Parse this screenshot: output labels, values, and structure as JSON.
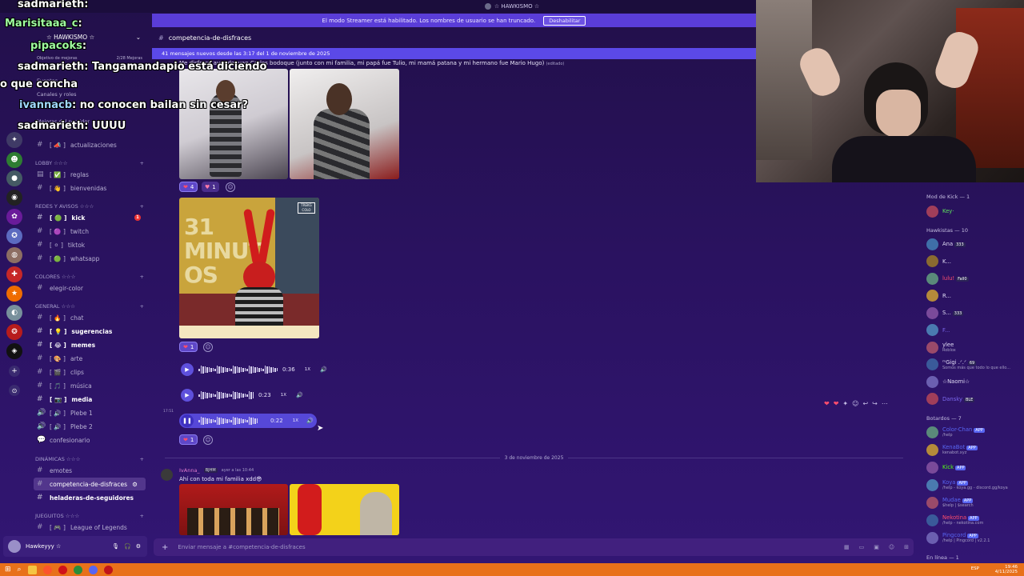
{
  "top_title": "☆ HAWKISMO ☆",
  "streamer_notice": {
    "text": "El modo Streamer está habilitado. Los nombres de usuario se han truncado.",
    "button": "Deshabilitar"
  },
  "server": {
    "name": "☆ HAWKISMO ☆",
    "goal_label": "Objetivo de mejoras",
    "goal_count": "2/28 Mejoras",
    "nav": [
      "Eventos",
      "Canales y roles",
      "Mejoras del servidor"
    ],
    "categories": [
      {
        "name": "LOBBY ☆☆☆"
      },
      {
        "name": "REDES Y AVISOS ☆☆☆"
      },
      {
        "name": "COLORES ☆☆☆"
      },
      {
        "name": "GENERAL ☆☆☆"
      },
      {
        "name": "DINÁMICAS ☆☆☆"
      },
      {
        "name": "JUEGUITOS ☆☆☆"
      }
    ],
    "channels": {
      "actualizaciones": "actualizaciones",
      "reglas": "reglas",
      "bienvenidas": "bienvenidas",
      "kick": "kick",
      "kick_badge": "1",
      "twitch": "twitch",
      "tiktok": "tiktok",
      "whatsapp": "whatsapp",
      "elegir_color": "elegir-color",
      "chat": "chat",
      "sugerencias": "sugerencias",
      "memes": "memes",
      "arte": "arte",
      "clips": "clips",
      "musica": "música",
      "media": "media",
      "plebe1": "Plebe 1",
      "plebe2": "Plebe 2",
      "confesionario": "confesionario",
      "emotes": "emotes",
      "competencia": "competencia-de-disfraces",
      "heladeras": "heladeras-de-seguidores",
      "lol": "League of Legends"
    }
  },
  "current_user": {
    "name": "Hawkeyyy ☆",
    "status": ""
  },
  "channel_header": "competencia-de-disfraces",
  "new_messages_banner": "41 mensajes nuevos desde las 3:17 del 1 de noviembre de 2025",
  "messages": {
    "first_text": "Me disfracé ayer de Juan Carlos bodoque (junto con mi familia, mi papá fue Tulio, mi mamá patana y mi hermano fue Mario Hugo)",
    "first_edited": "(editado)",
    "reactions1": [
      {
        "emoji": "❤",
        "count": "4"
      },
      {
        "emoji": "♥",
        "count": "1"
      }
    ],
    "video_badge": "TREKG COLO",
    "video_caption": "31 MINUTOS",
    "reactions2": [
      {
        "emoji": "❤",
        "count": "1"
      }
    ],
    "audios": [
      {
        "time": "0:36",
        "speed": "1X"
      },
      {
        "time": "0:23",
        "speed": "1X"
      },
      {
        "time": "0:22",
        "speed": "1X"
      }
    ],
    "audio_timestamp": "17:51",
    "reactions3": [
      {
        "emoji": "❤",
        "count": "1"
      }
    ],
    "date_separator": "3 de noviembre de 2025",
    "second_author": "IvAnna_",
    "second_tag": "BJHM",
    "second_time": "ayer a las 10:44",
    "second_text": "Ahí con toda mi familia xdd😎"
  },
  "composer_placeholder": "Enviar mensaje a #competencia-de-disfraces",
  "members": {
    "mod_header": "Mod de Kick — 1",
    "hawkistas_header": "Hawkistas — 10",
    "bots_header": "Botardos — 7",
    "online_header": "En línea — 1",
    "mods": [
      {
        "name": "Key·",
        "color": "#5ee35e"
      }
    ],
    "hawkistas": [
      {
        "name": "Ana",
        "sub": "",
        "color": "#e0dbf5",
        "tag": "333"
      },
      {
        "name": "K...",
        "sub": "",
        "color": "#e0dbf5",
        "tag": ""
      },
      {
        "name": "lulu!",
        "sub": "",
        "color": "#ff4d6d",
        "tag": "Fall0"
      },
      {
        "name": "R...",
        "sub": "",
        "color": "#e0dbf5",
        "tag": ""
      },
      {
        "name": "S...",
        "sub": "",
        "color": "#e0dbf5",
        "tag": "333"
      },
      {
        "name": "F...",
        "sub": "",
        "color": "#7b68ee",
        "tag": ""
      },
      {
        "name": "ylee",
        "sub": "Roblox",
        "color": "#e0dbf5",
        "tag": ""
      },
      {
        "name": "ᵐGigi .ᐟ.ᐟ",
        "sub": "Somos más que todo lo que ello...",
        "color": "#e0dbf5",
        "tag": "69"
      },
      {
        "name": "☆Naomi☆",
        "sub": "",
        "color": "#e0dbf5",
        "tag": ""
      },
      {
        "name": "Dansky",
        "sub": "",
        "color": "#7b68ee",
        "tag": "BLE"
      }
    ],
    "bots": [
      {
        "name": "Color-Chan",
        "sub": "/help",
        "color": "#5865f2"
      },
      {
        "name": "KenaBot",
        "sub": "kenabot.xyz",
        "color": "#5865f2"
      },
      {
        "name": "Kick",
        "sub": "",
        "color": "#53fc18"
      },
      {
        "name": "Koya",
        "sub": "/help - koya.gg - discord.gg/koya",
        "color": "#5865f2"
      },
      {
        "name": "Mudae",
        "sub": "$help | $search",
        "color": "#5865f2"
      },
      {
        "name": "Nekotina",
        "sub": "/help - nekotina.com",
        "color": "#ff4d6d"
      },
      {
        "name": "Pingcord",
        "sub": "/help | Pingcord | v2.2.1",
        "color": "#5865f2"
      }
    ],
    "app_tag": "APP"
  },
  "chat_overlay": [
    {
      "user": "sadmarieth",
      "text": ":",
      "color": "#ffffff"
    },
    {
      "user": "Marisitaaa_c",
      "text": ":",
      "color": "#9fff9f"
    },
    {
      "user": "pipacoks",
      "text": ":",
      "color": "#9fff9f"
    },
    {
      "user": "sadmarieth",
      "text": ": Tangamandapio está diciendo",
      "color": "#ffffff"
    },
    {
      "user": "",
      "text": "o que concha",
      "color": "#ffffff"
    },
    {
      "user": "ivannacb",
      "text": ": no conocen bailan sin cesar?",
      "color": "#a0d8ff"
    },
    {
      "user": "sadmarieth",
      "text": ": UUUU",
      "color": "#ffffff"
    }
  ],
  "taskbar": {
    "time": "19:46",
    "date": "4/11/2025",
    "lang": "ESP"
  },
  "colors": {
    "accent": "#5865f2",
    "background": "#2a1260",
    "taskbar": "#e8711a"
  }
}
